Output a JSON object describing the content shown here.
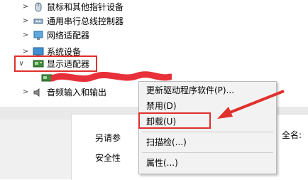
{
  "tree": {
    "items": [
      {
        "label": "鼠标和其他指针设备",
        "expanded": false,
        "icon": "mouse-icon"
      },
      {
        "label": "通用串行总线控制器",
        "expanded": false,
        "icon": "usb-icon"
      },
      {
        "label": "网络适配器",
        "expanded": false,
        "icon": "network-adapter-icon"
      },
      {
        "label": "系统设备",
        "expanded": false,
        "icon": "system-device-icon"
      },
      {
        "label": "显示适配器",
        "expanded": true,
        "icon": "display-adapter-icon"
      },
      {
        "label": "音频输入和输出",
        "expanded": false,
        "icon": "audio-icon"
      }
    ]
  },
  "dialog": {
    "line1": "另请参",
    "line1_right": "全名:",
    "line2": "安全性"
  },
  "context_menu": {
    "items": [
      {
        "label": "更新驱动程序软件(P)..."
      },
      {
        "label": "禁用(D)"
      },
      {
        "label": "卸载(U)"
      },
      {
        "label": "扫描检(...)"
      },
      {
        "label": "属性(...)"
      }
    ]
  },
  "colors": {
    "highlight_red": "#e0302b",
    "menu_bg": "#f2f2f2",
    "redaction": "#e8303a"
  }
}
